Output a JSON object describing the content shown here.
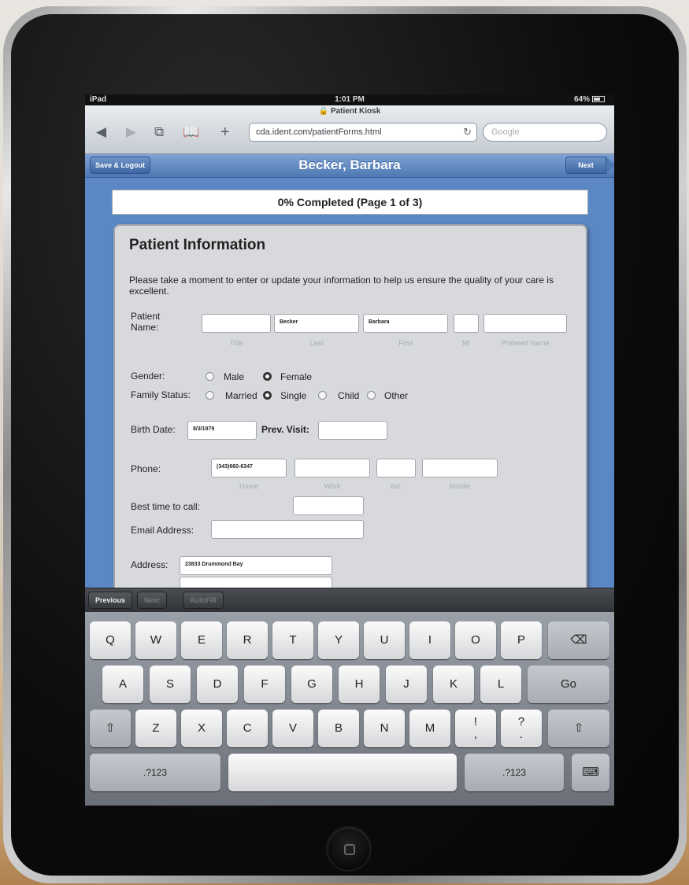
{
  "status": {
    "device": "iPad",
    "time": "1:01 PM",
    "battery": "64%"
  },
  "browser": {
    "page_title": "Patient Kiosk",
    "url": "cda.ident.com/patientForms.html",
    "search_placeholder": "Google"
  },
  "header": {
    "patient": "Becker, Barbara",
    "save_logout": "Save & Logout",
    "next": "Next"
  },
  "progress": {
    "text": "0% Completed (Page 1 of 3)",
    "percent": 0
  },
  "form": {
    "title": "Patient Information",
    "intro": "Please take a moment to enter or update your information to help us ensure the quality of your care is excellent.",
    "patient_name_label": "Patient Name:",
    "name_fields": [
      {
        "value": "",
        "sub": "Title"
      },
      {
        "value": "Becker",
        "sub": "Last"
      },
      {
        "value": "Barbara",
        "sub": "First"
      },
      {
        "value": "",
        "sub": "MI"
      },
      {
        "value": "",
        "sub": "Prefered Name"
      }
    ],
    "gender_label": "Gender:",
    "gender_options": [
      {
        "label": "Male",
        "selected": false
      },
      {
        "label": "Female",
        "selected": true
      }
    ],
    "family_label": "Family Status:",
    "family_options": [
      {
        "label": "Married",
        "selected": false
      },
      {
        "label": "Single",
        "selected": true
      },
      {
        "label": "Child",
        "selected": false
      },
      {
        "label": "Other",
        "selected": false
      }
    ],
    "birth_label": "Birth Date:",
    "birth_value": "8/3/1979",
    "prev_visit_label": "Prev. Visit:",
    "prev_visit_value": "",
    "phone_label": "Phone:",
    "phone_fields": [
      {
        "value": "(343)660-6347",
        "sub": "Home"
      },
      {
        "value": "",
        "sub": "Work"
      },
      {
        "value": "",
        "sub": "ext."
      },
      {
        "value": "",
        "sub": "Mobile"
      }
    ],
    "best_time_label": "Best time to call:",
    "best_time_value": "",
    "email_label": "Email Address:",
    "email_value": "",
    "address_label": "Address:",
    "address_line1": "23833 Drummond Bay",
    "address_line2": ""
  },
  "keyboard_toolbar": {
    "previous": "Previous",
    "next": "Next",
    "autofill": "AutoFill"
  },
  "keyboard": {
    "row1": [
      "Q",
      "W",
      "E",
      "R",
      "T",
      "Y",
      "U",
      "I",
      "O",
      "P"
    ],
    "row2": [
      "A",
      "S",
      "D",
      "F",
      "G",
      "H",
      "J",
      "K",
      "L"
    ],
    "row3": [
      "Z",
      "X",
      "C",
      "V",
      "B",
      "N",
      "M",
      "!",
      ",",
      "?",
      "."
    ],
    "go": "Go",
    "numbers": ".?123",
    "shift_icon": "⇧",
    "backspace_icon": "⌫",
    "hide_icon": "⌨"
  }
}
